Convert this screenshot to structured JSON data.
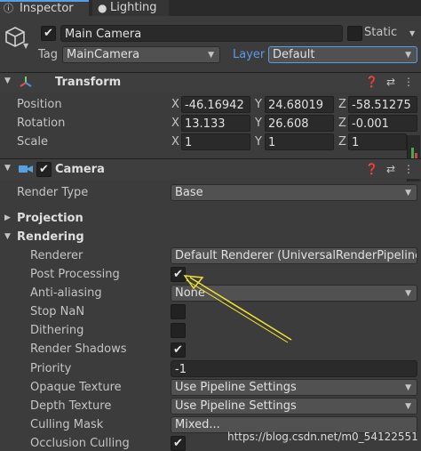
{
  "tabs": {
    "inspector": "Inspector",
    "lighting": "Lighting"
  },
  "header": {
    "object_name": "Main Camera",
    "static_label": "Static",
    "tag_label": "Tag",
    "tag_value": "MainCamera",
    "layer_label": "Layer",
    "layer_value": "Default"
  },
  "transform": {
    "title": "Transform",
    "position": {
      "label": "Position",
      "x": "-46.16942",
      "y": "24.68019",
      "z": "-58.51275"
    },
    "rotation": {
      "label": "Rotation",
      "x": "13.133",
      "y": "26.608",
      "z": "-0.001"
    },
    "scale": {
      "label": "Scale",
      "x": "1",
      "y": "1",
      "z": "1"
    },
    "axis": {
      "x": "X",
      "y": "Y",
      "z": "Z"
    }
  },
  "camera": {
    "title": "Camera",
    "render_type_label": "Render Type",
    "render_type_value": "Base",
    "projection_label": "Projection",
    "rendering_label": "Rendering",
    "renderer_label": "Renderer",
    "renderer_value": "Default Renderer (UniversalRenderPipeline",
    "post_processing_label": "Post Processing",
    "post_processing_checked": true,
    "antialiasing_label": "Anti-aliasing",
    "antialiasing_value": "None",
    "stop_nan_label": "Stop NaN",
    "stop_nan_checked": false,
    "dithering_label": "Dithering",
    "dithering_checked": false,
    "render_shadows_label": "Render Shadows",
    "render_shadows_checked": true,
    "priority_label": "Priority",
    "priority_value": "-1",
    "opaque_texture_label": "Opaque Texture",
    "opaque_texture_value": "Use Pipeline Settings",
    "depth_texture_label": "Depth Texture",
    "depth_texture_value": "Use Pipeline Settings",
    "culling_mask_label": "Culling Mask",
    "culling_mask_value": "Mixed...",
    "occlusion_culling_label": "Occlusion Culling",
    "occlusion_culling_checked": true
  },
  "icons": {
    "gameobject": "cube-icon",
    "transform": "transform-axes-icon",
    "camera": "camera-icon",
    "help": "help-icon",
    "presets": "presets-icon",
    "menu": "kebab-menu-icon",
    "arrow_annotation": "yellow-arrow-icon"
  },
  "colors": {
    "accent": "#5a9be6",
    "annotation": "#f0e030",
    "background": "#3c3c3c"
  },
  "watermark": "https://blog.csdn.net/m0_54122551"
}
